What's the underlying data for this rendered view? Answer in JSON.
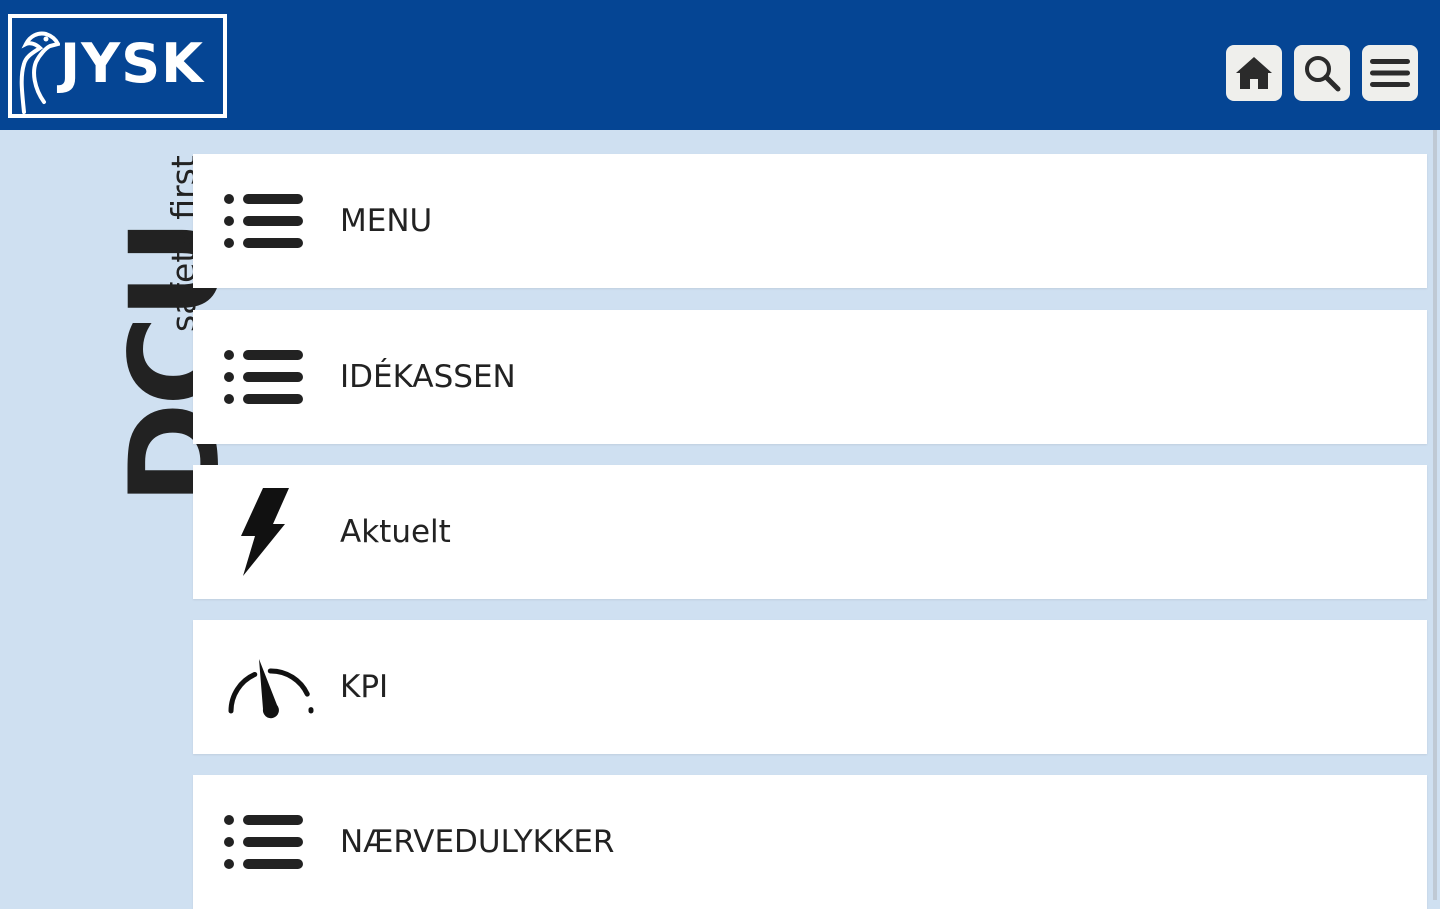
{
  "header": {
    "logo_text": "JYSK",
    "buttons": [
      {
        "name": "home",
        "icon": "home-icon"
      },
      {
        "name": "search",
        "icon": "search-icon"
      },
      {
        "name": "menu",
        "icon": "hamburger-menu-icon"
      }
    ]
  },
  "sidebar": {
    "title": "DCU",
    "tagline": "safety first"
  },
  "tiles": [
    {
      "label": "MENU",
      "icon": "list-icon"
    },
    {
      "label": "IDÉKASSEN",
      "icon": "list-icon"
    },
    {
      "label": "Aktuelt",
      "icon": "lightning-icon"
    },
    {
      "label": "KPI",
      "icon": "gauge-icon"
    },
    {
      "label": "NÆRVEDULYKKER",
      "icon": "list-icon"
    }
  ],
  "colors": {
    "header_bg": "#054594",
    "page_bg": "#cfe0f1",
    "tile_bg": "#ffffff",
    "text": "#222222",
    "button_bg": "#efefec"
  }
}
